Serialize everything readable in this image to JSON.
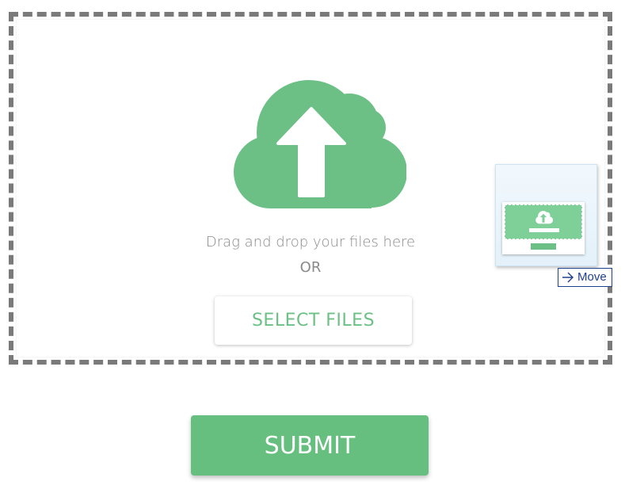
{
  "dropzone": {
    "drag_text": "Drag and drop your files here",
    "or_text": "OR",
    "select_label": "SELECT FILES",
    "icon": "cloud-upload-icon"
  },
  "drag_preview": {
    "tooltip_label": "Move",
    "tooltip_icon": "arrow-right-icon"
  },
  "submit": {
    "label": "SUBMIT"
  },
  "colors": {
    "accent": "#6cc086",
    "dashed_border": "#7a7a7a",
    "tooltip_border": "#1f3f8f"
  }
}
